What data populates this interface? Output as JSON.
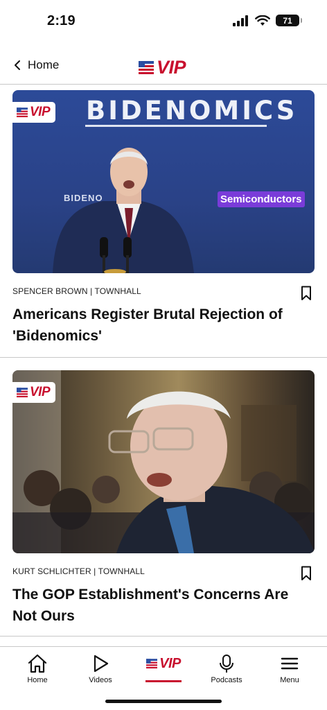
{
  "status_bar": {
    "time": "2:19",
    "battery": "71"
  },
  "header": {
    "back_label": "Home",
    "logo_text": "VIP"
  },
  "articles": [
    {
      "badge": "VIP",
      "byline": "SPENCER BROWN | TOWNHALL",
      "headline": "Americans Register Brutal Rejection of 'Bidenomics'",
      "image_text": {
        "title": "BIDENOMICS",
        "side": "BIDENO",
        "tag": "Semiconductors"
      }
    },
    {
      "badge": "VIP",
      "byline": "KURT SCHLICHTER | TOWNHALL",
      "headline": "The GOP Establishment's Concerns Are Not Ours"
    }
  ],
  "tabs": [
    {
      "label": "Home",
      "icon": "home-icon"
    },
    {
      "label": "Videos",
      "icon": "play-icon"
    },
    {
      "label": "VIP",
      "icon": "vip-logo",
      "active": true
    },
    {
      "label": "Podcasts",
      "icon": "microphone-icon"
    },
    {
      "label": "Menu",
      "icon": "menu-icon"
    }
  ],
  "colors": {
    "brand_red": "#c8102e",
    "brand_blue": "#2b4ea2",
    "divider": "#c8c8c8"
  }
}
